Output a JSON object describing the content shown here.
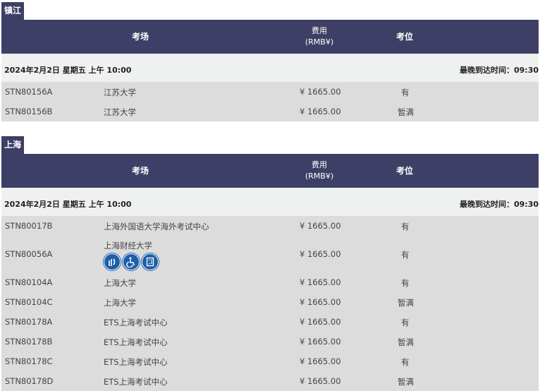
{
  "sections": [
    {
      "city": "镇江",
      "header": {
        "venue": "考场",
        "fee_line1": "费用",
        "fee_line2": "(RMB¥)",
        "seat": "考位"
      },
      "date": "2024年2月2日 星期五 上午 10:00",
      "arrival": "最晚到达时间：09:30",
      "rows": [
        {
          "code": "STN80156A",
          "venue": "江苏大学",
          "fee": "¥ 1665.00",
          "seat": "有"
        },
        {
          "code": "STN80156B",
          "venue": "江苏大学",
          "fee": "¥ 1665.00",
          "seat": "暂满"
        }
      ]
    },
    {
      "city": "上海",
      "header": {
        "venue": "考场",
        "fee_line1": "费用",
        "fee_line2": "(RMB¥)",
        "seat": "考位"
      },
      "date": "2024年2月2日 星期五 上午 10:00",
      "arrival": "最晚到达时间：09:30",
      "rows": [
        {
          "code": "STN80017B",
          "venue": "上海外国语大学海外考试中心",
          "fee": "¥ 1665.00",
          "seat": "有"
        },
        {
          "code": "STN80056A",
          "venue": "上海财经大学",
          "fee": "¥ 1665.00",
          "seat": "有",
          "icons": [
            "hearing-assistance-icon",
            "wheelchair-icon",
            "elevator-icon"
          ]
        },
        {
          "code": "STN80104A",
          "venue": "上海大学",
          "fee": "¥ 1665.00",
          "seat": "有"
        },
        {
          "code": "STN80104C",
          "venue": "上海大学",
          "fee": "¥ 1665.00",
          "seat": "暂满"
        },
        {
          "code": "STN80178A",
          "venue": "ETS上海考试中心",
          "fee": "¥ 1665.00",
          "seat": "有"
        },
        {
          "code": "STN80178B",
          "venue": "ETS上海考试中心",
          "fee": "¥ 1665.00",
          "seat": "暂满"
        },
        {
          "code": "STN80178C",
          "venue": "ETS上海考试中心",
          "fee": "¥ 1665.00",
          "seat": "有"
        },
        {
          "code": "STN80178D",
          "venue": "ETS上海考试中心",
          "fee": "¥ 1665.00",
          "seat": "暂满"
        }
      ]
    }
  ],
  "colors": {
    "header_bg": "#3e3f66",
    "row_bg": "#dcdcdc",
    "date_bg": "#eff0f0",
    "icon_blue": "#1c5ea8"
  }
}
